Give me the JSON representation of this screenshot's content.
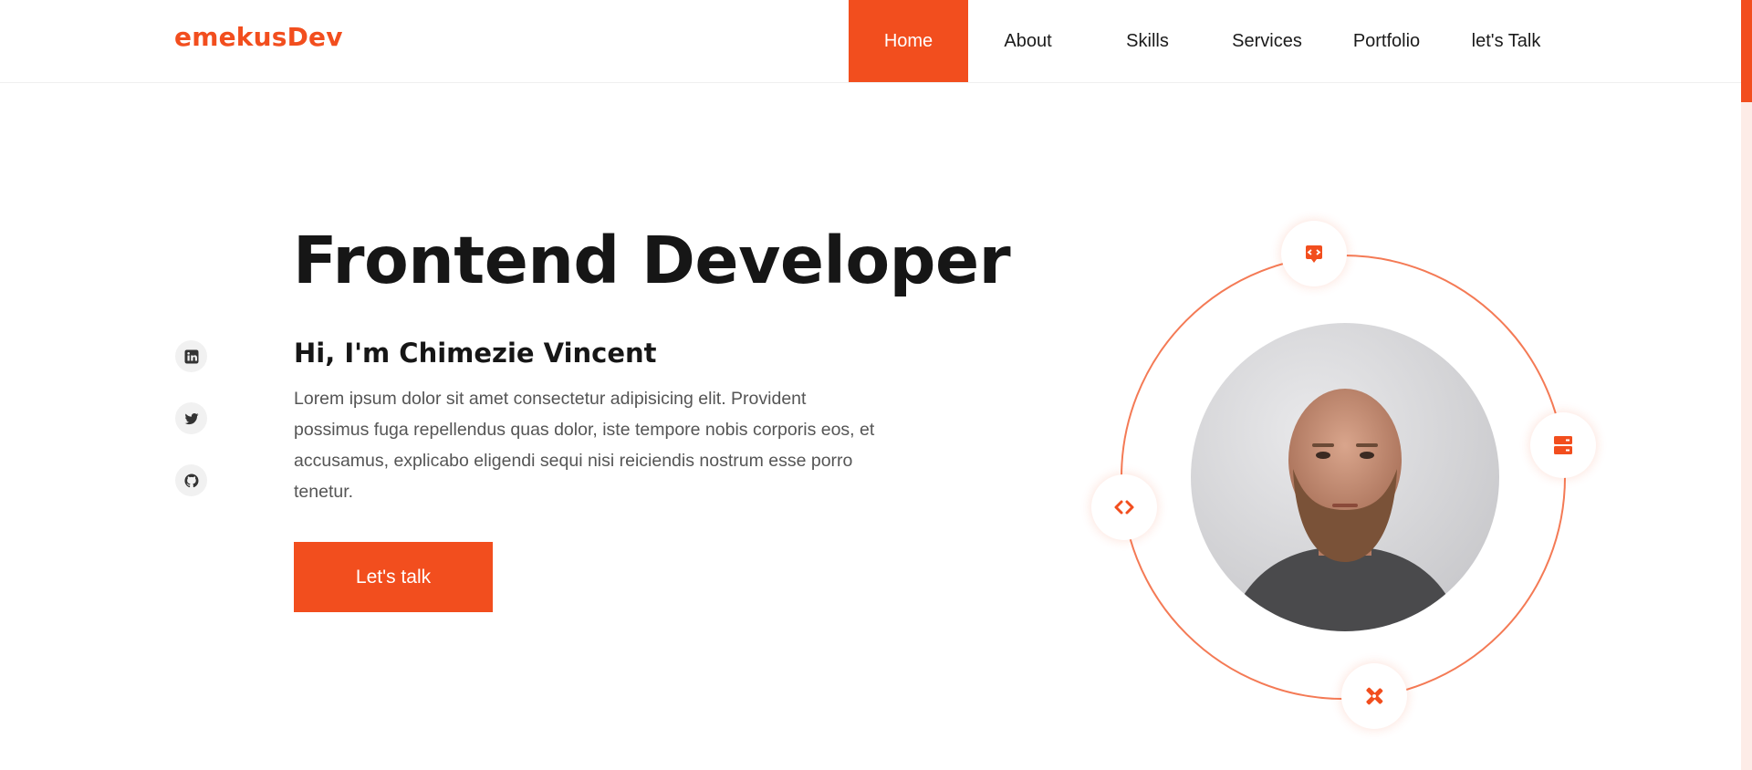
{
  "brand": {
    "logo": "emekusDev",
    "accent": "#f24e1e"
  },
  "nav": {
    "items": [
      {
        "label": "Home",
        "active": true
      },
      {
        "label": "About",
        "active": false
      },
      {
        "label": "Skills",
        "active": false
      },
      {
        "label": "Services",
        "active": false
      },
      {
        "label": "Portfolio",
        "active": false
      },
      {
        "label": "let's Talk",
        "active": false
      }
    ]
  },
  "social": {
    "icons": [
      "linkedin-icon",
      "twitter-icon",
      "github-icon"
    ]
  },
  "hero": {
    "title": "Frontend Developer",
    "subtitle": "Hi, I'm Chimezie Vincent",
    "description": "Lorem ipsum dolor sit amet consectetur adipisicing elit. Provident possimus fuga repellendus quas dolor, iste tempore nobis corporis eos, et accusamus, explicabo eligendi sequi nisi reiciendis nostrum esse porro tenetur.",
    "cta_label": "Let's talk"
  },
  "orbit_icons": [
    "code-badge-icon",
    "server-icon",
    "code-icon",
    "tools-icon"
  ]
}
